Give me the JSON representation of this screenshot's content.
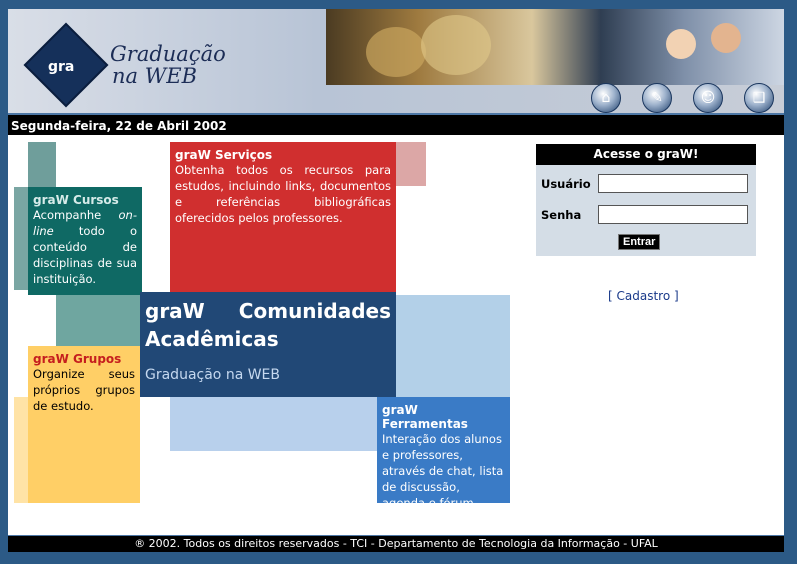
{
  "header": {
    "logo_mark": "gra",
    "logo_line1": "Graduação",
    "logo_line2": "na WEB",
    "toolbar": [
      {
        "name": "home-icon",
        "glyph": "⌂"
      },
      {
        "name": "edit-icon",
        "glyph": "✎"
      },
      {
        "name": "user-icon",
        "glyph": "☺"
      },
      {
        "name": "book-icon",
        "glyph": "❑"
      }
    ]
  },
  "date": "Segunda-feira, 22 de Abril 2002",
  "boxes": {
    "servicos": {
      "title": "graW Serviços",
      "text": "Obtenha todos os recursos para estudos, incluindo links, documentos e referências bibliográficas oferecidos pelos professores."
    },
    "cursos": {
      "title": "graW Cursos",
      "text_pre": "Acompanhe ",
      "text_em": "on-line",
      "text_post": " todo o conteúdo de disciplinas de sua instituição."
    },
    "comunidades": {
      "title": "graW Comunidades Acadêmicas",
      "subtitle": "Graduação na WEB"
    },
    "grupos": {
      "title": "graW Grupos",
      "text": "Organize seus próprios grupos de estudo."
    },
    "ferramentas": {
      "title": "graW Ferramentas",
      "text": "Interação dos alunos e professores, através de chat, lista de discussão, agenda e fórum."
    }
  },
  "login": {
    "title": "Acesse o graW!",
    "user_label": "Usuário",
    "pass_label": "Senha",
    "user_value": "",
    "pass_value": "",
    "submit": "Entrar"
  },
  "cadastro": "[ Cadastro ]",
  "footer": "® 2002. Todos os direitos reservados - TCI - Departamento de Tecnologia da Informação - UFAL",
  "colors": {
    "red": "#d02f2f",
    "teal": "#0f6964",
    "navy": "#214876",
    "yellow": "#ffcf66",
    "blue": "#3a7bc6"
  }
}
